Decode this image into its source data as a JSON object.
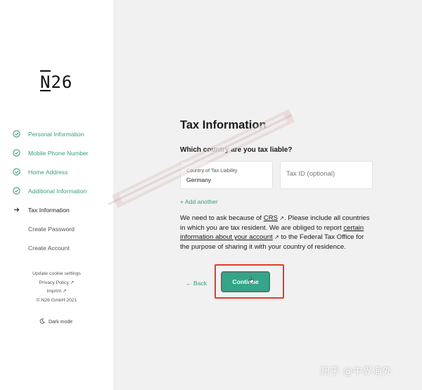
{
  "brand": {
    "logo": "N26"
  },
  "sidebar": {
    "steps": [
      {
        "label": "Personal Information",
        "state": "done"
      },
      {
        "label": "Mobile Phone Number",
        "state": "done"
      },
      {
        "label": "Home Address",
        "state": "done"
      },
      {
        "label": "Additional Information",
        "state": "done"
      },
      {
        "label": "Tax Information",
        "state": "current"
      },
      {
        "label": "Create Password",
        "state": "todo"
      },
      {
        "label": "Create Account",
        "state": "todo"
      }
    ],
    "footer": {
      "cookie": "Update cookie settings",
      "privacy": "Privacy Policy ↗",
      "imprint": "Imprint ↗",
      "copyright": "© N26 GmbH 2021"
    },
    "dark_mode": "Dark mode"
  },
  "main": {
    "title": "Tax Information",
    "question": "Which country are you tax liable?",
    "country_field": {
      "label": "Country of Tax Liability",
      "value": "Germany"
    },
    "tax_field": {
      "placeholder": "Tax ID (optional)",
      "value": ""
    },
    "add_another": "+ Add another",
    "paragraph": {
      "t1": "We need to ask because of ",
      "crs": "CRS",
      "arrow": " ↗",
      "t2": ". Please include all countries in which you are tax resident. We are obliged to report ",
      "certain": "certain information about your account",
      "t3": " to the Federal Tax Office for the purpose of sharing it with your country of residence."
    },
    "back": "← Back",
    "continue": "Continue"
  },
  "watermark": "知乎 @中界海外",
  "colors": {
    "accent": "#35a58a",
    "accent_text": "#3a9c83",
    "highlight": "#e33a2c"
  }
}
